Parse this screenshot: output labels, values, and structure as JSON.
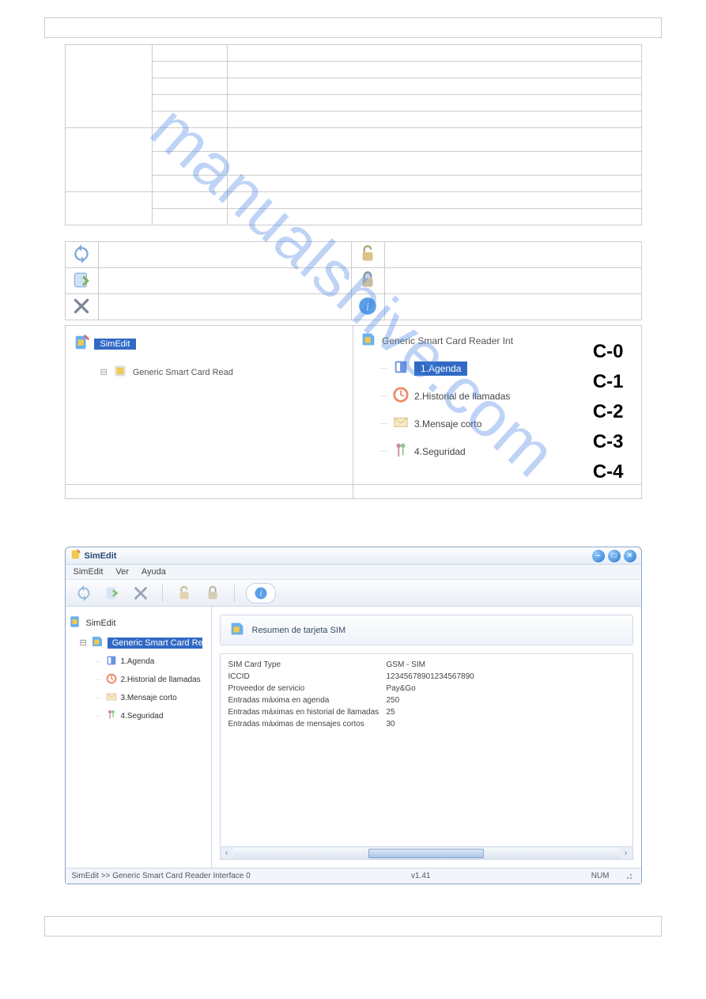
{
  "watermark": "manualshive.com",
  "icons": {
    "refresh": "refresh",
    "export": "export",
    "close": "close",
    "unlock": "unlock",
    "lock": "lock",
    "info": "info"
  },
  "tree_panel_left": {
    "root": "SimEdit",
    "child": "Generic Smart Card Read"
  },
  "tree_panel_right": {
    "root": "Generic Smart Card Reader Int",
    "items": [
      {
        "label": "1.Agenda",
        "selected": true
      },
      {
        "label": "2.Historial de llamadas",
        "selected": false
      },
      {
        "label": "3.Mensaje corto",
        "selected": false
      },
      {
        "label": "4.Seguridad",
        "selected": false
      }
    ],
    "c_labels": [
      "C-0",
      "C-1",
      "C-2",
      "C-3",
      "C-4"
    ]
  },
  "app": {
    "title": "SimEdit",
    "menubar": [
      "SimEdit",
      "Ver",
      "Ayuda"
    ],
    "tree": {
      "root": "SimEdit",
      "reader": "Generic Smart Card Reader Int",
      "items": [
        "1.Agenda",
        "2.Historial de llamadas",
        "3.Mensaje corto",
        "4.Seguridad"
      ]
    },
    "summary_title": "Resumen de tarjeta SIM",
    "info": [
      {
        "k": "SIM Card Type",
        "v": "GSM - SIM"
      },
      {
        "k": "ICCID",
        "v": "12345678901234567890"
      },
      {
        "k": "Proveedor de servicio",
        "v": "Pay&Go"
      },
      {
        "k": "Entradas máxima en agenda",
        "v": "250"
      },
      {
        "k": "Entradas máximas en historial de llamadas",
        "v": "25"
      },
      {
        "k": "Entradas máximas de mensajes cortos",
        "v": "30"
      }
    ],
    "status_left": "SimEdit  >>  Generic Smart Card Reader Interface 0",
    "status_version": "v1.41",
    "status_right": "NUM"
  }
}
